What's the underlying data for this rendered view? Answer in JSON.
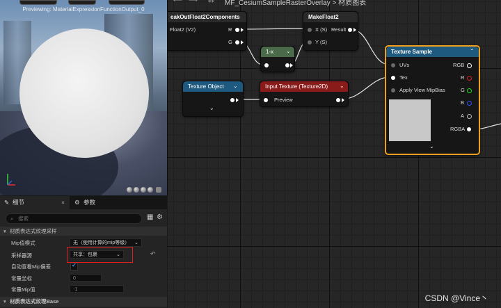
{
  "preview": {
    "title": "Previewing: MaterialExpressionFunctionOutput_0"
  },
  "graph_header": {
    "title": "MF_CesiumSampleRasterOverlay > 材质图表"
  },
  "details": {
    "tab_details": "细节",
    "tab_params": "参数",
    "search_placeholder": "搜索",
    "section1": "材质表达式纹理采样",
    "rows": {
      "mip_mode_label": "Mip值模式",
      "mip_mode_value": "无（使用计算的mip等级）",
      "sampler_label": "采样器源",
      "sampler_value": "共享：包裹",
      "auto_mip_label": "自动查看Mip偏差",
      "const_coord_label": "常量坐标",
      "const_coord_value": "0",
      "const_mip_label": "常量Mip值",
      "const_mip_value": "-1"
    },
    "section2": "材质表达式纹理Base"
  },
  "nodes": {
    "break": {
      "title": "eakOutFloat2Components",
      "pin_in": "Float2 (V2)",
      "pin_r": "R",
      "pin_g": "G"
    },
    "make": {
      "title": "MakeFloat2",
      "pin_x": "X (S)",
      "pin_y": "Y (S)",
      "pin_out": "Result"
    },
    "oneminus": {
      "title": "1-x"
    },
    "texobj": {
      "title": "Texture Object"
    },
    "input": {
      "title": "Input Texture (Texture2D)",
      "pin_preview": "Preview"
    },
    "sample": {
      "title": "Texture Sample",
      "pin_uvs": "UVs",
      "pin_tex": "Tex",
      "pin_mip": "Apply View MipBias",
      "out_rgb": "RGB",
      "out_r": "R",
      "out_g": "G",
      "out_b": "B",
      "out_a": "A",
      "out_rgba": "RGBA"
    }
  },
  "colors": {
    "input_header": "#8a1b1b",
    "texobj_header": "#1e5a80",
    "sample_header": "#1e5a80",
    "oneminus_header": "#4a6a4a",
    "selection": "#f0a020",
    "highlight_box": "#e02020"
  },
  "watermark": "CSDN @Vince丶"
}
